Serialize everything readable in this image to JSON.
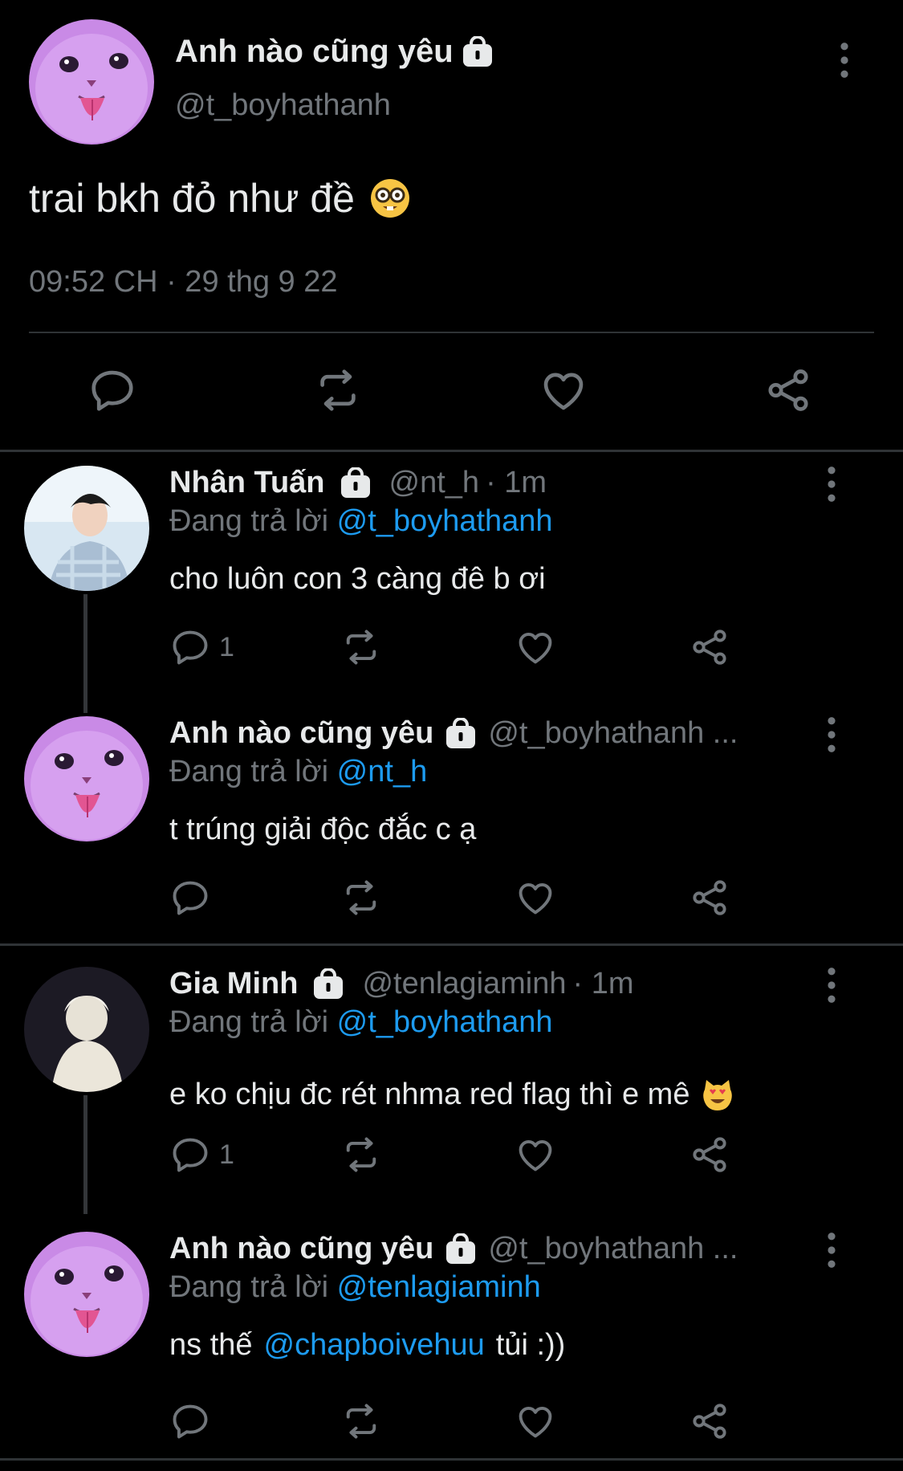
{
  "main_tweet": {
    "author_name": "Anh nào cũng yêu",
    "handle": "@t_boyhathanh",
    "text": "trai bkh đỏ như đề",
    "emoji": "nerd-face",
    "timestamp": "09:52 CH · 29 thg 9 22",
    "actions": [
      "reply-icon",
      "retweet-icon",
      "like-icon",
      "share-icon"
    ]
  },
  "replies": [
    {
      "author_name": "Nhân Tuấn",
      "handle": "@nt_h",
      "time": "· 1m",
      "replying_label": "Đang trả lời",
      "replying_to": "@t_boyhathanh",
      "text": "cho luôn con 3 càng đê b ơi",
      "reply_count": "1",
      "avatar": "person-photo"
    },
    {
      "author_name": "Anh nào cũng yêu",
      "handle": "@t_boyhathanh ...",
      "time": "",
      "replying_label": "Đang trả lời",
      "replying_to": "@nt_h",
      "text": "t trúng giải độc đắc c ạ",
      "reply_count": "",
      "avatar": "purple-cat"
    },
    {
      "author_name": "Gia Minh",
      "handle": "@tenlagiaminh",
      "time": "· 1m",
      "replying_label": "Đang trả lời",
      "replying_to": "@t_boyhathanh",
      "text": "e ko chịu đc rét nhma red flag thì e mê",
      "emoji": "smiling-cat-heart-eyes",
      "reply_count": "1",
      "avatar": "person-photo"
    },
    {
      "author_name": "Anh nào cũng yêu",
      "handle": "@t_boyhathanh ...",
      "time": "",
      "replying_label": "Đang trả lời",
      "replying_to": "@tenlagiaminh",
      "text_before": "ns thế",
      "text_mention": "@chapboivehuu",
      "text_after": "tủi :))",
      "reply_count": "",
      "avatar": "purple-cat"
    }
  ],
  "colors": {
    "background": "#000000",
    "text": "#e7e9ea",
    "muted": "#71767b",
    "link": "#1d9bf0",
    "divider": "#2f3336",
    "avatar_purple": "#c98ae6"
  }
}
